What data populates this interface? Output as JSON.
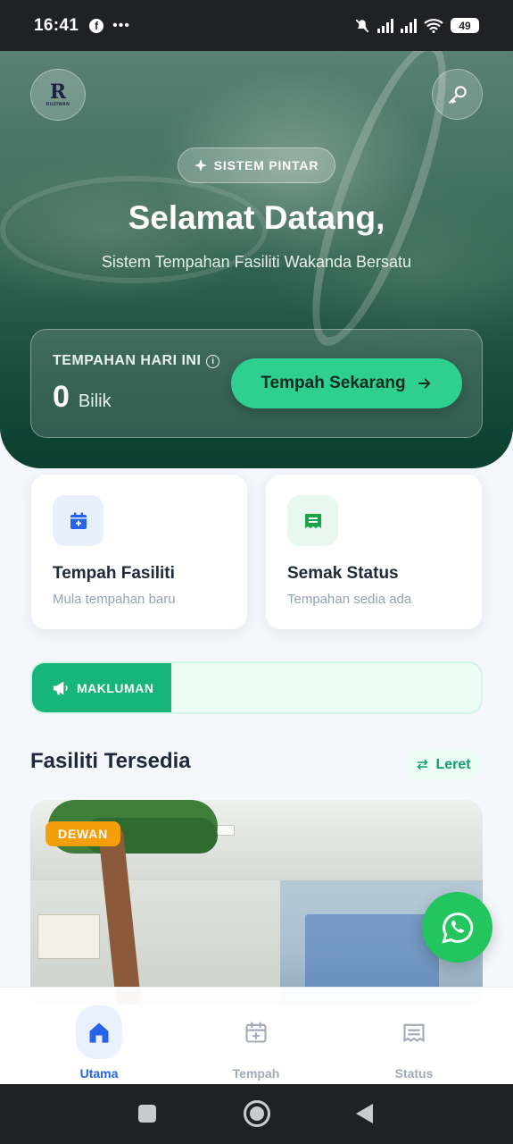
{
  "status_bar": {
    "time": "16:41",
    "battery": "49"
  },
  "hero": {
    "badge": "SISTEM PINTAR",
    "title": "Selamat Datang,",
    "subtitle": "Sistem Tempahan Fasiliti Wakanda Bersatu",
    "logo_letter": "R",
    "logo_text": "RUZIWAN",
    "today_label": "TEMPAHAN HARI INI",
    "today_count": "0",
    "today_unit": "Bilik",
    "book_button": "Tempah Sekarang"
  },
  "actions": [
    {
      "title": "Tempah Fasiliti",
      "subtitle": "Mula tempahan baru",
      "icon": "calendar-plus-icon"
    },
    {
      "title": "Semak Status",
      "subtitle": "Tempahan sedia ada",
      "icon": "receipt-icon"
    }
  ],
  "notice": {
    "label": "MAKLUMAN",
    "text": ""
  },
  "facilities": {
    "title": "Fasiliti Tersedia",
    "scroll_label": "Leret",
    "items": [
      {
        "category": "DEWAN"
      }
    ]
  },
  "bottom_nav": [
    {
      "label": "Utama",
      "icon": "home-icon",
      "active": true
    },
    {
      "label": "Tempah",
      "icon": "calendar-plus-icon",
      "active": false
    },
    {
      "label": "Status",
      "icon": "receipt-icon",
      "active": false
    }
  ],
  "colors": {
    "primary_green": "#2fd08f",
    "accent_blue": "#2563eb",
    "badge_orange": "#f59e0b",
    "whatsapp": "#22c55e"
  }
}
